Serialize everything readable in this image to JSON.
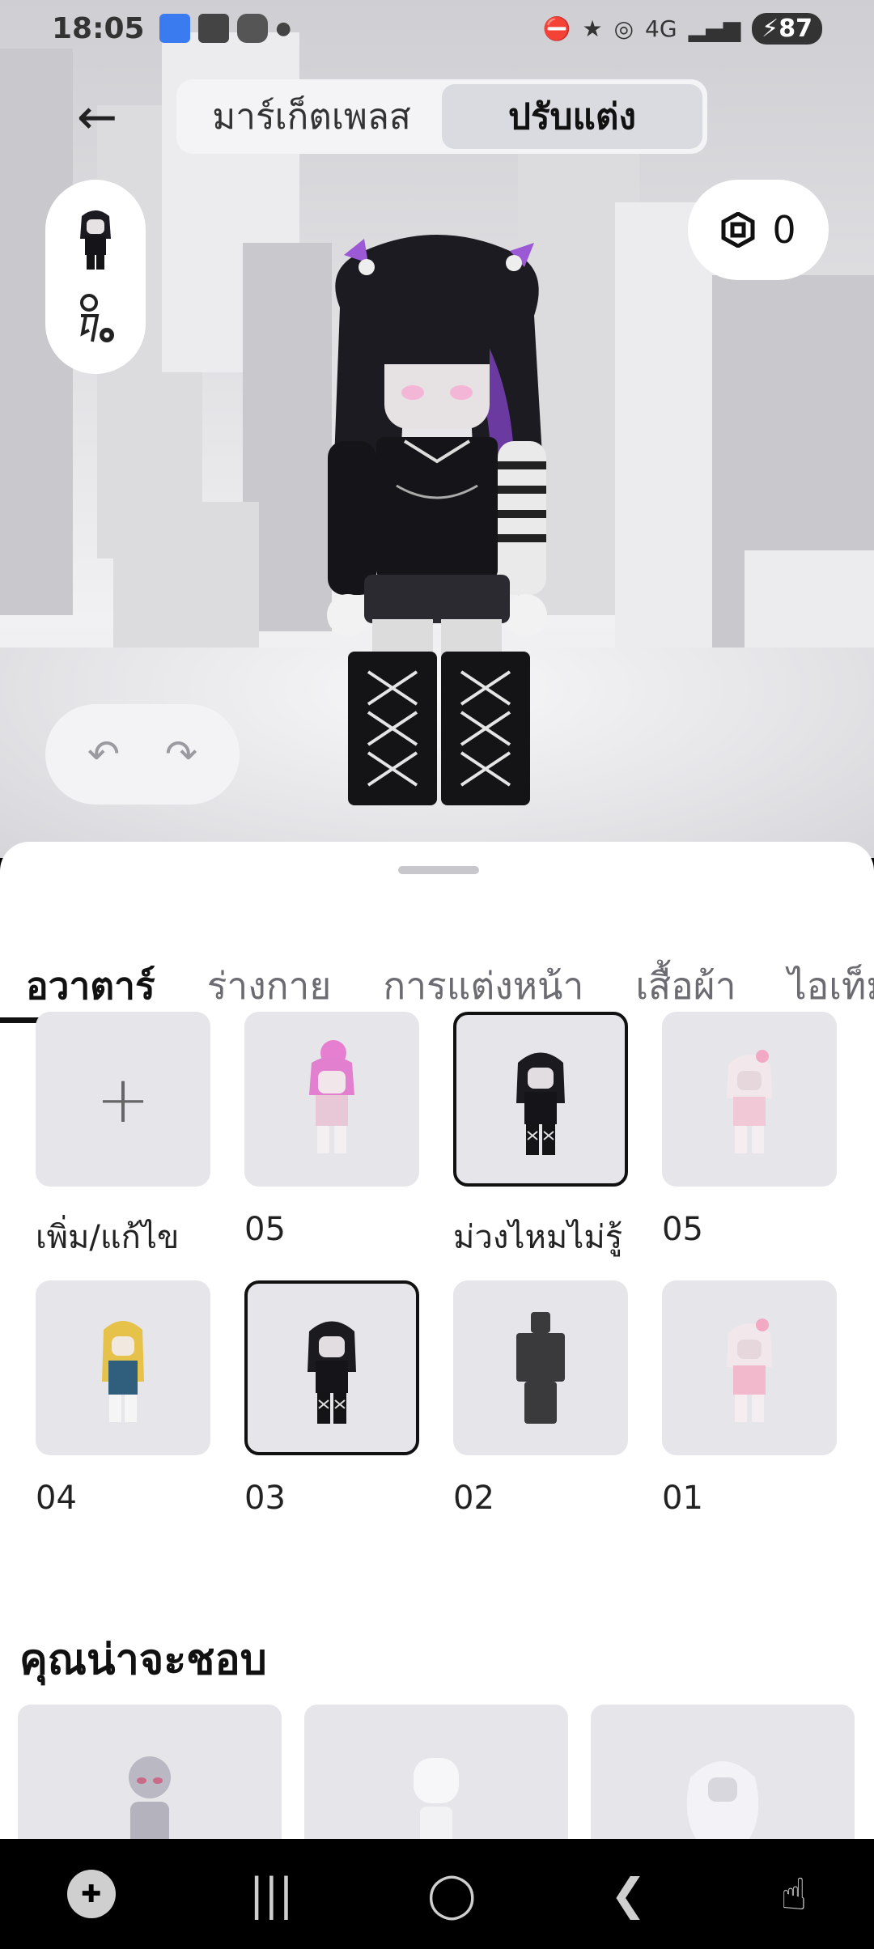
{
  "status_bar": {
    "time": "18:05",
    "network": "4G",
    "battery": "87"
  },
  "header": {
    "back_icon": "arrow-left-icon",
    "segments": [
      {
        "label": "มาร์เก็ตเพลส",
        "active": false
      },
      {
        "label": "ปรับแต่ง",
        "active": true
      }
    ]
  },
  "currency": {
    "icon": "robux-icon",
    "amount": "0"
  },
  "undo_redo": {
    "undo_icon": "undo-icon",
    "redo_icon": "redo-icon"
  },
  "tabs": [
    {
      "label": "อวาตาร์",
      "active": true
    },
    {
      "label": "ร่างกาย",
      "active": false
    },
    {
      "label": "การแต่งหน้า",
      "active": false
    },
    {
      "label": "เสื้อผ้า",
      "active": false
    },
    {
      "label": "ไอเท็ม",
      "active": false
    }
  ],
  "outfits": [
    {
      "label": "เพิ่ม/แก้ไข",
      "kind": "add",
      "selected": false
    },
    {
      "label": "05",
      "kind": "pink-hair",
      "selected": false
    },
    {
      "label": "ม่วงไหมไม่รู้",
      "kind": "dark-goth",
      "selected": true
    },
    {
      "label": "05",
      "kind": "pink-hood",
      "selected": false
    },
    {
      "label": "04",
      "kind": "blonde",
      "selected": false
    },
    {
      "label": "03",
      "kind": "dark-goth",
      "selected": true
    },
    {
      "label": "02",
      "kind": "blank",
      "selected": false
    },
    {
      "label": "01",
      "kind": "pink-hood",
      "selected": false
    }
  ],
  "recommend": {
    "title": "คุณน่าจะชอบ"
  },
  "colors": {
    "accent": "#111111",
    "tile": "#e6e6ea",
    "hair_purple": "#7a3fb0"
  }
}
